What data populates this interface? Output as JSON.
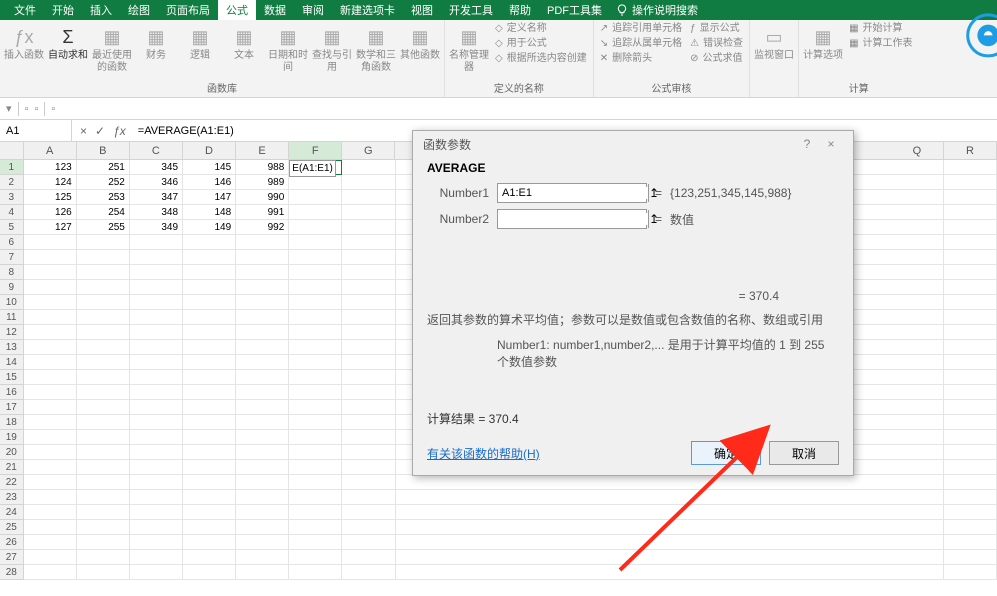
{
  "menu": {
    "items": [
      "文件",
      "开始",
      "插入",
      "绘图",
      "页面布局",
      "公式",
      "数据",
      "审阅",
      "新建选项卡",
      "视图",
      "开发工具",
      "帮助",
      "PDF工具集"
    ],
    "active_index": 5,
    "hint": "操作说明搜索"
  },
  "ribbon": {
    "group1": {
      "insert_fn": "插入函数",
      "autosum": "自动求和",
      "recent": "最近使用的函数",
      "finance": "财务",
      "logic": "逻辑",
      "text": "文本",
      "datetime": "日期和时间",
      "lookup": "查找与引用",
      "math": "数学和三角函数",
      "other": "其他函数",
      "label": "函数库"
    },
    "group2": {
      "name_mgr": "名称管理器",
      "define": "定义名称",
      "usein": "用于公式",
      "create": "根据所选内容创建",
      "label": "定义的名称"
    },
    "group3": {
      "trace_prec": "追踪引用单元格",
      "trace_dep": "追踪从属单元格",
      "remove_arrows": "删除箭头",
      "show_fm": "显示公式",
      "err_check": "错误检查",
      "eval": "公式求值",
      "label": "公式审核"
    },
    "group4": {
      "watch": "监视窗口"
    },
    "group5": {
      "calc_opt": "计算选项",
      "calc_now": "开始计算",
      "calc_sheet": "计算工作表",
      "label": "计算"
    }
  },
  "formula_bar": {
    "cell_ref": "A1",
    "formula": "=AVERAGE(A1:E1)"
  },
  "grid": {
    "cols": [
      "A",
      "B",
      "C",
      "D",
      "E",
      "F",
      "G",
      "Q",
      "R"
    ],
    "rows": [
      [
        "123",
        "251",
        "345",
        "145",
        "  988",
        "E(A1:E1)",
        ""
      ],
      [
        "124",
        "252",
        "346",
        "146",
        "989",
        "",
        ""
      ],
      [
        "125",
        "253",
        "347",
        "147",
        "990",
        "",
        ""
      ],
      [
        "126",
        "254",
        "348",
        "148",
        "991",
        "",
        ""
      ],
      [
        "127",
        "255",
        "349",
        "149",
        "992",
        "",
        ""
      ]
    ],
    "active_col": 5,
    "cell_overlay": "E(A1:E1)"
  },
  "dialog": {
    "title": "函数参数",
    "help": "?",
    "close": "×",
    "fn": "AVERAGE",
    "n1_label": "Number1",
    "n1_value": "A1:E1",
    "n1_preview": "{123,251,345,145,988}",
    "n2_label": "Number2",
    "n2_preview": "数值",
    "eq": "=",
    "mid_result": "= 370.4",
    "desc": "返回其参数的算术平均值；参数可以是数值或包含数值的名称、数组或引用",
    "desc2": "Number1:  number1,number2,... 是用于计算平均值的 1 到 255 个数值参数",
    "result_label": "计算结果 =  370.4",
    "help_link": "有关该函数的帮助(H)",
    "ok": "确定",
    "cancel": "取消"
  }
}
